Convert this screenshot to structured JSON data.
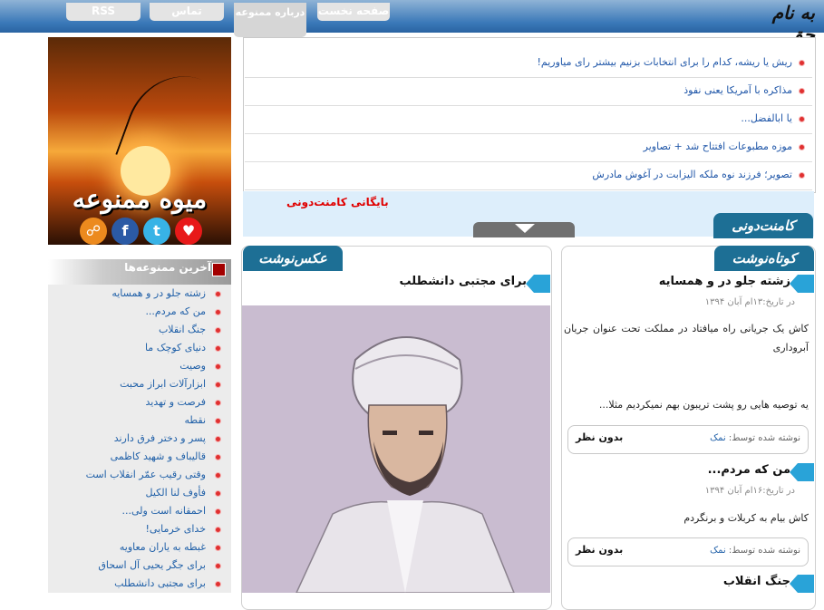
{
  "header": {
    "logo_text": "به نام حق",
    "tabs": [
      {
        "label": "صفحه نخست"
      },
      {
        "label": "درباره ممنوعه"
      },
      {
        "label": "تماس"
      },
      {
        "label": "RSS"
      }
    ]
  },
  "sidebar": {
    "brand_word": "میوه ممنوعه",
    "latest_title": "آخرین ممنوعه‌ها",
    "latest_items": [
      "زشته جلو در و همسایه",
      "من که مردم...",
      "جنگ انقلاب",
      "دنیای کوچک ما",
      "وصیت",
      "ابزارآلات ابراز محبت",
      "فرصت و تهدید",
      "نقطه",
      "پسر و دختر فرق دارند",
      "قالیباف و شهید کاظمی",
      "وقتی رقیب عمّر انقلاب است",
      "فأوف لنا الکیل",
      "احمقانه است ولی...",
      "خدای خرمایی!",
      "غبطه به یاران معاویه",
      "برای جگر یحیی آل اسحاق",
      "برای مجتبی دانشطلب"
    ]
  },
  "news": {
    "items": [
      "ریش یا ریشه، کدام را برای انتخابات بزنیم بیشتر رای میاوریم!",
      "مذاکره با آمریکا یعنی نفوذ",
      "یا ابالفضل...",
      "موزه مطبوعات افتتاح شد + تصاویر",
      "تصویر؛ فرزند نوه ملکه الیزابت در آغوش مادرش"
    ],
    "section_label": "کامنت‌دونی",
    "archive_link": "بایگانی کامنت‌دونی"
  },
  "photo_panel": {
    "ribbon": "عکس‌نوشت",
    "post_title": "برای مجتبی دانشطلب"
  },
  "short_panel": {
    "ribbon": "کوتاه‌نوشت",
    "posts": [
      {
        "title": "زشته جلو در و همسایه",
        "date": "در تاریخ:۱۳ام آبان ۱۳۹۴",
        "body": "کاش یک جریانی راه میافتاد در مملکت تحت عنوان جریان آبروداری",
        "body2": "یه توصیه هایی رو پشت تریبون بهم نمیکردیم مثلا...",
        "author_label": "نوشته شده توسط:",
        "author": "نمک",
        "comments": "بدون نظر"
      },
      {
        "title": "من که مردم...",
        "date": "در تاریخ:۱۶ام آبان ۱۳۹۴",
        "body": "کاش بیام به کربلات و برنگردم",
        "author_label": "نوشته شده توسط:",
        "author": "نمک",
        "comments": "بدون نظر"
      },
      {
        "title": "جنگ انقلاب"
      }
    ]
  },
  "colors": {
    "topbar": "#3a78b8",
    "ribbon": "#1d6f95",
    "arrow": "#29a3d8",
    "link": "#2060a8",
    "archive": "#e00000"
  }
}
